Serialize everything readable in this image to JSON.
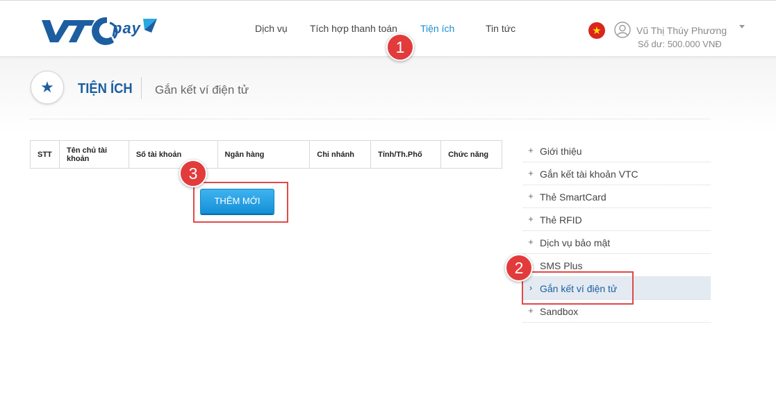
{
  "header": {
    "logo_text": "VTC PAY",
    "nav": [
      {
        "label": "Dịch vụ",
        "active": false
      },
      {
        "label": "Tích hợp thanh toán",
        "active": false
      },
      {
        "label": "Tiện ích",
        "active": true
      },
      {
        "label": "Tin tức",
        "active": false
      }
    ],
    "user_name": "Vũ Thị Thúy Phương",
    "balance_label": "Số dư:",
    "balance_value": "500.000 VNĐ"
  },
  "page": {
    "title": "TIỆN ÍCH",
    "subtitle": "Gắn kết ví điện tử"
  },
  "table": {
    "headers": [
      "STT",
      "Tên chủ tài khoản",
      "Số tài khoản",
      "Ngân hàng",
      "Chi nhánh",
      "Tỉnh/Th.Phố",
      "Chức năng"
    ]
  },
  "add_button_label": "THÊM MỚI",
  "sidebar": {
    "items": [
      {
        "label": "Giới thiệu",
        "mark": "+"
      },
      {
        "label": "Gắn kết tài khoản VTC",
        "mark": "+"
      },
      {
        "label": "Thẻ SmartCard",
        "mark": "+"
      },
      {
        "label": "Thẻ RFID",
        "mark": "+"
      },
      {
        "label": "Dịch vụ bảo mật",
        "mark": "+"
      },
      {
        "label": "SMS Plus",
        "mark": "+"
      },
      {
        "label": "Gắn kết ví điện tử",
        "mark": "›",
        "active": true
      },
      {
        "label": "Sandbox",
        "mark": "+"
      }
    ]
  },
  "annotations": [
    "1",
    "2",
    "3"
  ],
  "colors": {
    "brand_blue": "#1c5ea0",
    "nav_active": "#1a8fd0",
    "button_blue": "#1590d8",
    "annotation_red": "#e23b3b"
  }
}
